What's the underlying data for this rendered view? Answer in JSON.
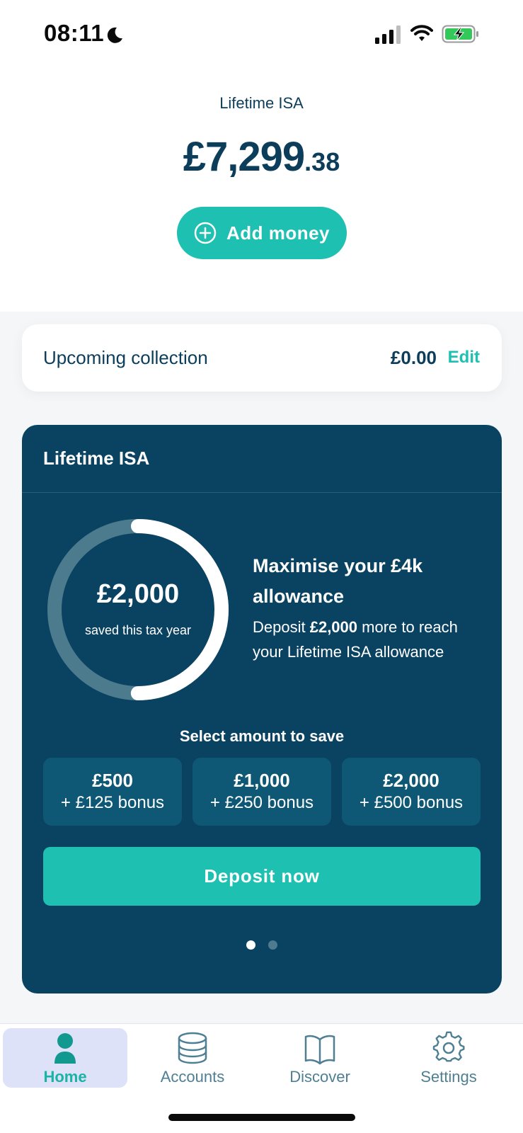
{
  "status_bar": {
    "time": "08:11",
    "icons": [
      "moon-icon",
      "signal-icon",
      "wifi-icon",
      "battery-charging-icon"
    ]
  },
  "header": {
    "account_title": "Lifetime ISA",
    "balance_main": "£7,299",
    "balance_pence": ".38",
    "add_money_label": "Add money"
  },
  "upcoming": {
    "label": "Upcoming collection",
    "amount": "£0.00",
    "edit_label": "Edit"
  },
  "isa_card": {
    "title": "Lifetime ISA",
    "ring_amount": "£2,000",
    "ring_caption": "saved this tax year",
    "ring_progress": 0.5,
    "promo_heading": "Maximise your £4k allowance",
    "promo_text_prefix": "Deposit ",
    "promo_text_bold": "£2,000",
    "promo_text_suffix": " more to reach your Lifetime ISA allowance",
    "select_label": "Select amount to save",
    "options": [
      {
        "amount": "£500",
        "bonus": "+ £125 bonus"
      },
      {
        "amount": "£1,000",
        "bonus": "+ £250 bonus"
      },
      {
        "amount": "£2,000",
        "bonus": "+ £500 bonus"
      }
    ],
    "deposit_label": "Deposit now",
    "pagination": {
      "current": 1,
      "total": 2
    }
  },
  "tab_bar": {
    "tabs": [
      {
        "label": "Home",
        "icon": "person-icon",
        "active": true
      },
      {
        "label": "Accounts",
        "icon": "database-stack-icon",
        "active": false
      },
      {
        "label": "Discover",
        "icon": "open-book-icon",
        "active": false
      },
      {
        "label": "Settings",
        "icon": "gear-icon",
        "active": false
      }
    ]
  },
  "colors": {
    "brand_teal": "#1ec0b1",
    "navy": "#0c3d5a",
    "card_navy": "#0a4361",
    "option_tile": "#0e5875",
    "active_tab_bg": "#dde2f8"
  }
}
